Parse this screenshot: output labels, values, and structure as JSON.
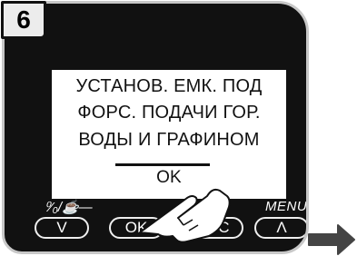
{
  "step": {
    "number": "6"
  },
  "display": {
    "line1": "УСТАНОВ. ЕМК. ПОД",
    "line2": "ФОРС. ПОДАЧИ ГОР.",
    "line3": "ВОДЫ И ГРАФИНОМ",
    "ok": "OK"
  },
  "buttons": {
    "left_label": "⁰⁄₀/☕—",
    "menu_label": "MENU",
    "down": "V",
    "ok": "OK",
    "esc": "ESC",
    "up": "Λ"
  },
  "colors": {
    "body": "#111111",
    "screen": "#ffffff",
    "bezel": "#c8c8c8"
  },
  "icons": [
    "hand-pointer-icon",
    "next-arrow-icon",
    "drop-percent-icon"
  ]
}
